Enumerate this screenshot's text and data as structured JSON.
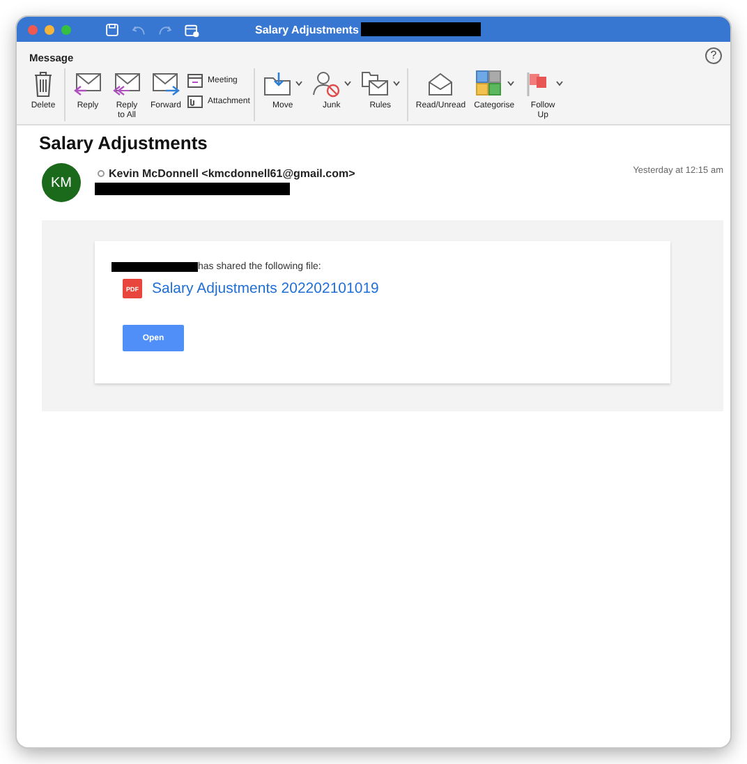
{
  "window": {
    "title": "Salary Adjustments",
    "title_redacted": true,
    "quick_access": [
      {
        "disabled": false
      },
      {
        "disabled": true
      },
      {
        "disabled": true
      },
      {
        "disabled": false
      }
    ]
  },
  "tabs": [
    {
      "label": "Message",
      "selected": true
    }
  ],
  "help": "?",
  "ribbon": [
    {
      "items": [
        {
          "kind": "large",
          "label": "Delete",
          "has_menu": false
        }
      ]
    },
    {
      "items": [
        {
          "kind": "large",
          "label": "Reply",
          "has_menu": false
        },
        {
          "kind": "large",
          "label": "Reply\nto All",
          "has_menu": false
        },
        {
          "kind": "large",
          "label": "Forward",
          "has_menu": false
        },
        {
          "kind": "small",
          "label": "Meeting",
          "has_menu": false
        },
        {
          "kind": "small",
          "label": "Attachment",
          "has_menu": false
        }
      ]
    },
    {
      "items": [
        {
          "kind": "large",
          "label": "Move",
          "has_menu": true
        },
        {
          "kind": "large",
          "label": "Junk",
          "has_menu": true
        },
        {
          "kind": "large",
          "label": "Rules",
          "has_menu": true
        }
      ]
    },
    {
      "items": [
        {
          "kind": "large",
          "label": "Read/Unread",
          "has_menu": false
        },
        {
          "kind": "large",
          "label": "Categorise",
          "has_menu": true
        },
        {
          "kind": "large",
          "label": "Follow\nUp",
          "has_menu": true
        }
      ]
    }
  ],
  "message": {
    "subject": "Salary Adjustments",
    "avatar_initials": "KM",
    "sender": "Kevin McDonnell <kmcdonnell61@gmail.com>",
    "recipient_redacted": true,
    "time": "Yesterday at 12:15 am",
    "body": {
      "sharer_redacted": true,
      "shared_text": "has shared the following file:",
      "file_icon_label": "PDF",
      "file_name": "Salary Adjustments 202202101019",
      "button": "Open"
    }
  }
}
